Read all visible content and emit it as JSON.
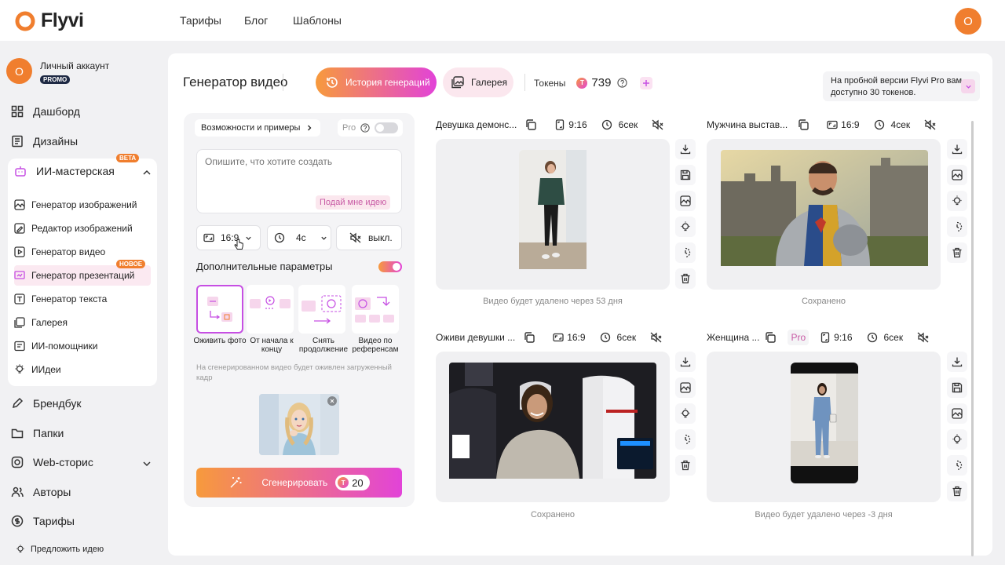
{
  "app": {
    "logo_text": "Flyvi",
    "avatar_letter": "O"
  },
  "topnav": [
    "Тарифы",
    "Блог",
    "Шаблоны"
  ],
  "sidebar": {
    "account": {
      "name": "Личный аккаунт",
      "badge": "PROMO",
      "avatar_letter": "O"
    },
    "items": [
      {
        "label": "Дашборд",
        "icon": "grid-icon"
      },
      {
        "label": "Дизайны",
        "icon": "document-icon"
      },
      {
        "label": "ИИ-мастерская",
        "icon": "robot-icon",
        "badge": "BETA"
      },
      {
        "label": "Брендбук",
        "icon": "pen-icon"
      },
      {
        "label": "Папки",
        "icon": "folder-icon"
      },
      {
        "label": "Web-сторис",
        "icon": "instagram-icon"
      },
      {
        "label": "Авторы",
        "icon": "users-icon"
      },
      {
        "label": "Тарифы",
        "icon": "dollar-icon"
      }
    ],
    "sub_items": [
      {
        "label": "Генератор изображений",
        "icon": "image-icon"
      },
      {
        "label": "Редактор изображений",
        "icon": "edit-image-icon"
      },
      {
        "label": "Генератор видео",
        "icon": "video-icon"
      },
      {
        "label": "Генератор презентаций",
        "icon": "presentation-icon",
        "badge": "НОВОЕ"
      },
      {
        "label": "Генератор текста",
        "icon": "text-icon"
      },
      {
        "label": "Галерея",
        "icon": "gallery-icon"
      },
      {
        "label": "ИИ-помощники",
        "icon": "chat-icon"
      },
      {
        "label": "ИИдеи",
        "icon": "bulb-icon"
      }
    ],
    "suggest": "Предложить идею"
  },
  "header": {
    "title": "Генератор видео",
    "history_btn": "История генераций",
    "gallery_btn": "Галерея",
    "tokens_label": "Токены",
    "tokens_value": "739",
    "trial_text": "На пробной версии Flyvi Pro вам доступно 30 токенов."
  },
  "panel": {
    "possibilities": "Возможности и примеры",
    "pro_label": "Pro",
    "prompt_placeholder": "Опишите, что хотите создать",
    "idea_btn": "Подай мне идею",
    "aspect": "16:9",
    "duration": "4с",
    "sound": "выкл.",
    "additional_params": "Дополнительные параметры",
    "modes": [
      {
        "label": "Оживить фото"
      },
      {
        "label": "От начала к концу"
      },
      {
        "label": "Снять продолжение"
      },
      {
        "label": "Видео по референсам"
      }
    ],
    "note": "На сгенерированном видео будет оживлен загруженный кадр",
    "generate_btn": "Сгенерировать",
    "generate_cost": "20"
  },
  "cards": [
    {
      "title": "Девушка демонс...",
      "aspect": "9:16",
      "duration": "6сек",
      "caption": "Видео будет удалено через 53 дня"
    },
    {
      "title": "Мужчина выстав...",
      "aspect": "16:9",
      "duration": "4сек",
      "caption": "Сохранено"
    },
    {
      "title": "Оживи девушки ...",
      "aspect": "16:9",
      "duration": "6сек",
      "caption": "Сохранено"
    },
    {
      "title": "Женщина ...",
      "pro": "Pro",
      "aspect": "9:16",
      "duration": "6сек",
      "caption": "Видео будет удалено через -3 дня"
    }
  ],
  "colors": {
    "accent_orange": "#f79a3c",
    "accent_pink": "#e243d8",
    "avatar": "#f07e2e"
  }
}
